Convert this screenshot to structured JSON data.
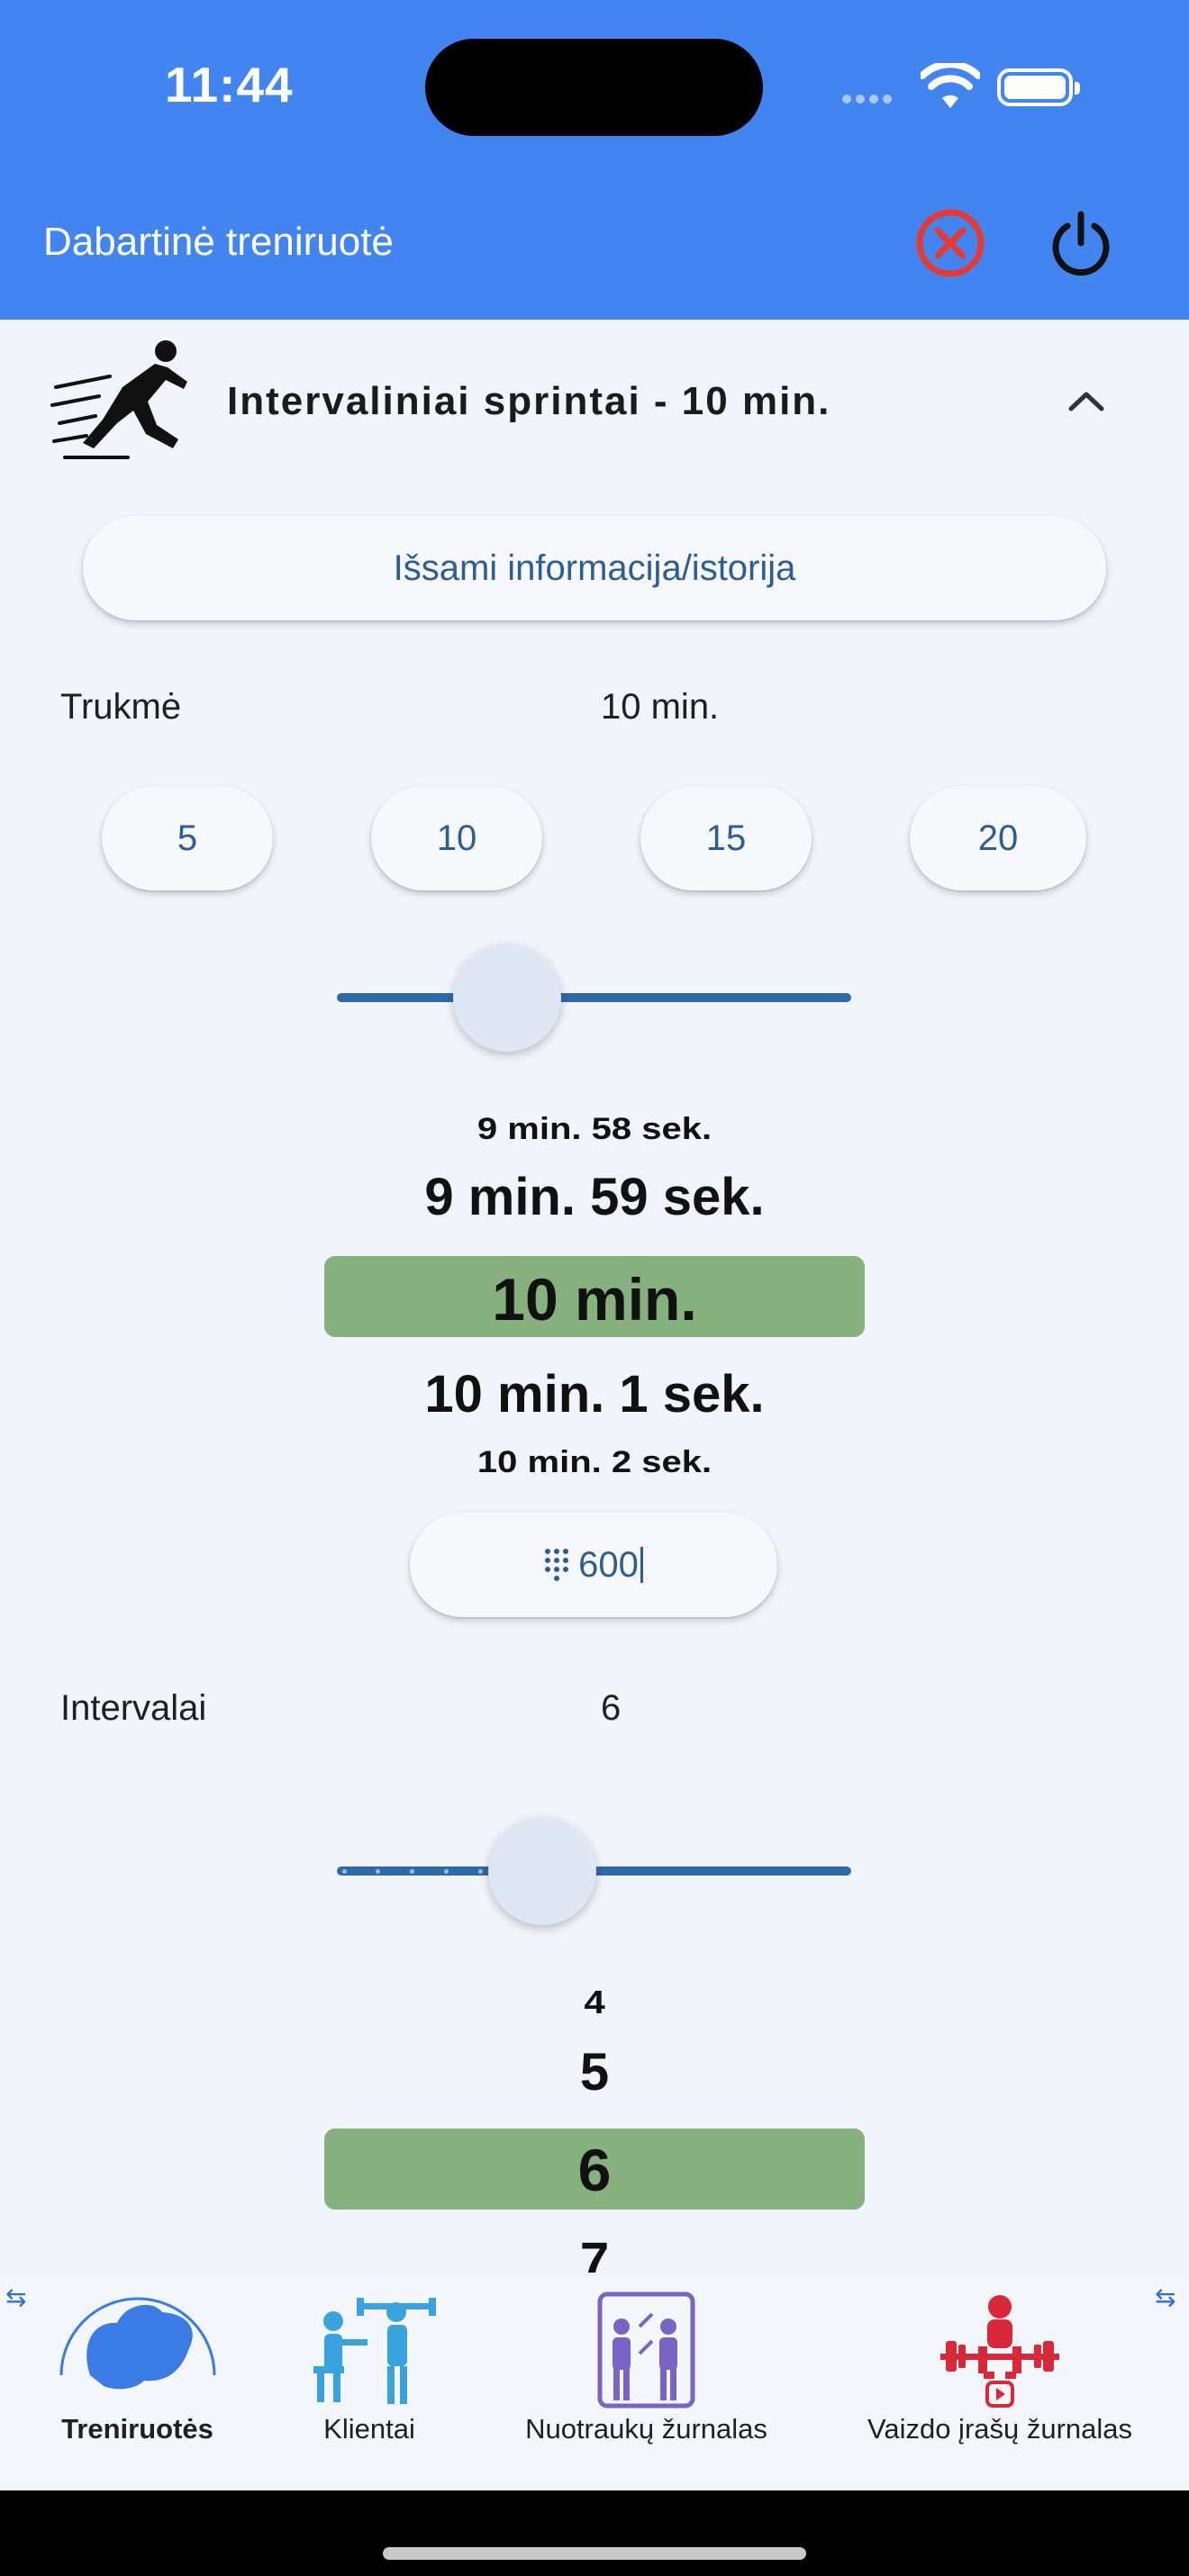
{
  "status_bar": {
    "time": "11:44"
  },
  "app_bar": {
    "title": "Dabartinė treniruotė",
    "cancel_icon": "close-circle-icon",
    "power_icon": "power-icon",
    "cancel_color": "#e53935"
  },
  "workout": {
    "title": "Intervaliniai sprintai - 10 min.",
    "details_button": "Išsami informacija/istorija",
    "duration": {
      "label": "Trukmė",
      "value": "10 min.",
      "presets": [
        "5",
        "10",
        "15",
        "20"
      ],
      "slider_fraction": 0.33,
      "wheel": [
        "9 min. 58 sek.",
        "9 min. 59 sek.",
        "10 min.",
        "10 min. 1 sek.",
        "10 min. 2 sek."
      ],
      "seconds_input": "600",
      "keypad_icon": "dialpad-icon"
    },
    "intervals": {
      "label": "Intervalai",
      "value": "6",
      "slider_fraction": 0.4,
      "wheel": [
        "4",
        "5",
        "6",
        "7"
      ]
    }
  },
  "bottom_nav": {
    "items": [
      {
        "label": "Treniruotės",
        "icon": "flexed-arm-icon",
        "active": true
      },
      {
        "label": "Klientai",
        "icon": "trainer-clients-icon",
        "active": false
      },
      {
        "label": "Nuotraukų žurnalas",
        "icon": "mirror-photo-icon",
        "active": false
      },
      {
        "label": "Vaizdo įrašų žurnalas",
        "icon": "weightlifter-video-icon",
        "active": false
      }
    ]
  },
  "colors": {
    "primary": "#4285f0",
    "selected_wheel": "#86b17f",
    "accent_text": "#2c5d93"
  }
}
